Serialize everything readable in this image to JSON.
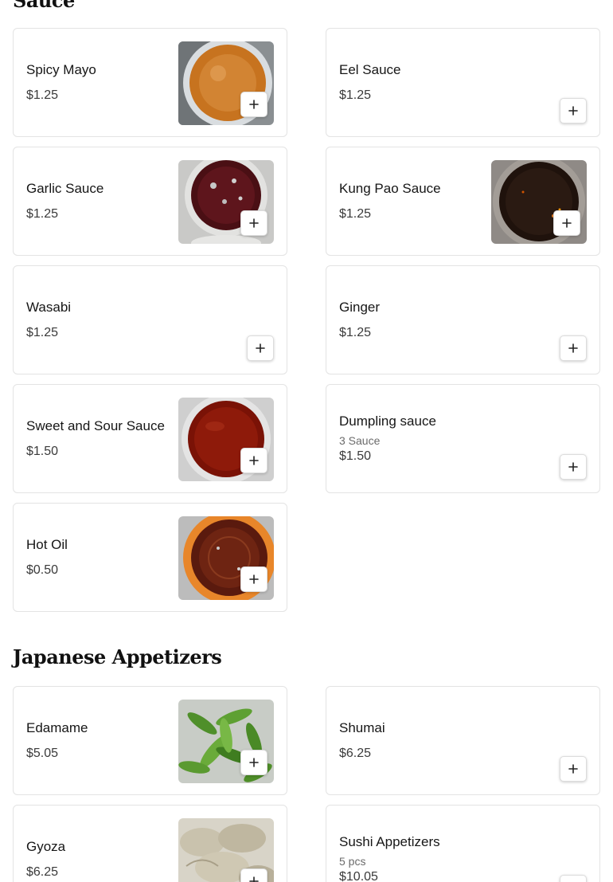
{
  "sections": [
    {
      "title": "Sauce"
    },
    {
      "title": "Japanese Appetizers"
    }
  ],
  "items": {
    "spicy_mayo": {
      "name": "Spicy Mayo",
      "price": "$1.25",
      "image": "orange-sauce-cup"
    },
    "eel_sauce": {
      "name": "Eel Sauce",
      "price": "$1.25"
    },
    "garlic_sauce": {
      "name": "Garlic Sauce",
      "price": "$1.25",
      "image": "dark-garlic-sauce-cup"
    },
    "kung_pao": {
      "name": "Kung Pao Sauce",
      "price": "$1.25",
      "image": "black-kung-pao-sauce-cup"
    },
    "wasabi": {
      "name": "Wasabi",
      "price": "$1.25"
    },
    "ginger": {
      "name": "Ginger",
      "price": "$1.25"
    },
    "sweet_sour": {
      "name": "Sweet and Sour Sauce",
      "price": "$1.50",
      "image": "red-sauce-cup"
    },
    "dumpling_sauce": {
      "name": "Dumpling sauce",
      "desc": "3 Sauce",
      "price": "$1.50"
    },
    "hot_oil": {
      "name": "Hot Oil",
      "price": "$0.50",
      "image": "chili-oil-cup"
    },
    "edamame": {
      "name": "Edamame",
      "price": "$5.05",
      "image": "edamame-pods"
    },
    "shumai": {
      "name": "Shumai",
      "price": "$6.25"
    },
    "gyoza": {
      "name": "Gyoza",
      "price": "$6.25",
      "image": "gyoza-dumplings"
    },
    "sushi_app": {
      "name": "Sushi Appetizers",
      "desc": "5 pcs",
      "price": "$10.05"
    }
  },
  "icons": {
    "add": "plus-icon"
  },
  "colors": {
    "border": "#e3e3e3",
    "text": "#161616",
    "muted": "#6b6b6b"
  }
}
